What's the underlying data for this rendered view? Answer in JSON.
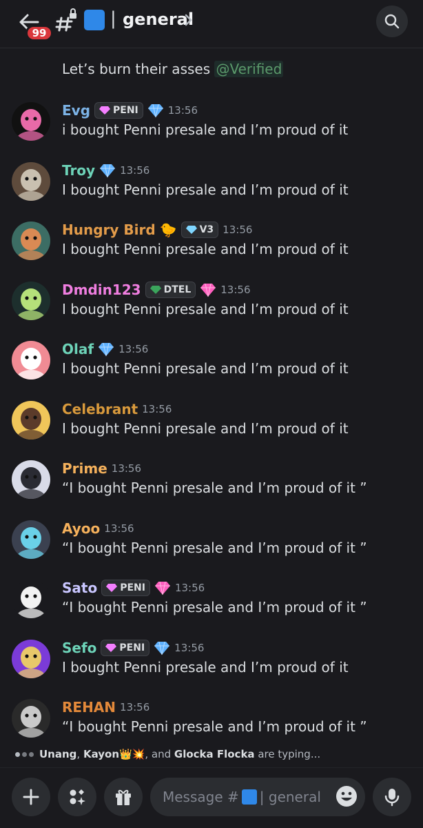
{
  "header": {
    "notification_count": "99",
    "separator": "|",
    "channel_name": "general"
  },
  "top_message": {
    "text": "Let’s burn their asses ",
    "mention": "@Verified"
  },
  "messages": [
    {
      "user": "Evg",
      "color": "#7cb3e6",
      "tag": "PENI",
      "tag_color": "#f47fff",
      "gem": "#5fb2ff",
      "time": "13:56",
      "text": "i bought Penni presale and I’m proud of it"
    },
    {
      "user": "Troy",
      "color": "#6dd3b8",
      "tag": "",
      "gem": "#5fb2ff",
      "time": "13:56",
      "text": "I bought Penni presale and I’m proud of it"
    },
    {
      "user": "Hungry Bird",
      "color": "#e39c4a",
      "tag": "V3",
      "tag_color": "#7fd6ff",
      "extra": "🐤",
      "gem": "",
      "time": "13:56",
      "text": "I bought Penni presale and I’m proud of it"
    },
    {
      "user": "Dmdin123",
      "color": "#f07ee0",
      "tag": "DTEL",
      "tag_color": "#3ba55c",
      "gem": "#ff5fbf",
      "time": "13:56",
      "text": "I bought Penni presale and I’m proud of it"
    },
    {
      "user": "Olaf",
      "color": "#6dd3b8",
      "tag": "",
      "gem": "#5fb2ff",
      "time": "13:56",
      "text": "I bought Penni presale and I’m proud of it"
    },
    {
      "user": "Celebrant",
      "color": "#d99a3c",
      "tag": "",
      "gem": "",
      "time": "13:56",
      "text": "I bought Penni presale and I’m proud of it"
    },
    {
      "user": "Prime",
      "color": "#f5b15c",
      "tag": "",
      "gem": "",
      "time": "13:56",
      "text": "“I bought Penni presale and I’m proud of it ”"
    },
    {
      "user": "Ayoo",
      "color": "#f5b15c",
      "tag": "",
      "gem": "",
      "time": "13:56",
      "text": "“I bought Penni presale and I’m proud of it ”"
    },
    {
      "user": "Sato",
      "color": "#c9c6ff",
      "tag": "PENI",
      "tag_color": "#f47fff",
      "gem": "#ff5fbf",
      "time": "13:56",
      "text": "“I bought Penni presale and I’m proud of it ”"
    },
    {
      "user": "Sefo",
      "color": "#6dd3b8",
      "tag": "PENI",
      "tag_color": "#f47fff",
      "gem": "#5fb2ff",
      "time": "13:56",
      "text": "I bought Penni presale and I’m proud of it"
    },
    {
      "user": "REHAN",
      "color": "#e3893a",
      "tag": "",
      "gem": "",
      "time": "13:56",
      "text": "“I bought Penni presale and I’m proud of it ”"
    }
  ],
  "typing": {
    "name1": "Unang",
    "sep1": ", ",
    "name2": "Kayon",
    "name2_emojis": "👑💥",
    "sep2": ", and ",
    "name3": "Glocka Flocka",
    "suffix": " are typing..."
  },
  "composer": {
    "placeholder_prefix": "Message #",
    "placeholder_suffix": " | general"
  },
  "avatars": [
    {
      "bg": "#111",
      "fg": "#e86aa8"
    },
    {
      "bg": "#5e4b3c",
      "fg": "#c9c0b0"
    },
    {
      "bg": "#3c6d64",
      "fg": "#d98a54"
    },
    {
      "bg": "#1d2f2d",
      "fg": "#b5e07a"
    },
    {
      "bg": "#f08b94",
      "fg": "#ffffff"
    },
    {
      "bg": "#f0c65a",
      "fg": "#5b3b2a"
    },
    {
      "bg": "#d9dbe8",
      "fg": "#2a2b33"
    },
    {
      "bg": "#3b4150",
      "fg": "#6ad0e8"
    },
    {
      "bg": "#1a1a1e",
      "fg": "#f2f2f2"
    },
    {
      "bg": "#7b3bd8",
      "fg": "#e8c86a"
    },
    {
      "bg": "#2a2a2a",
      "fg": "#c9c9c9"
    }
  ]
}
